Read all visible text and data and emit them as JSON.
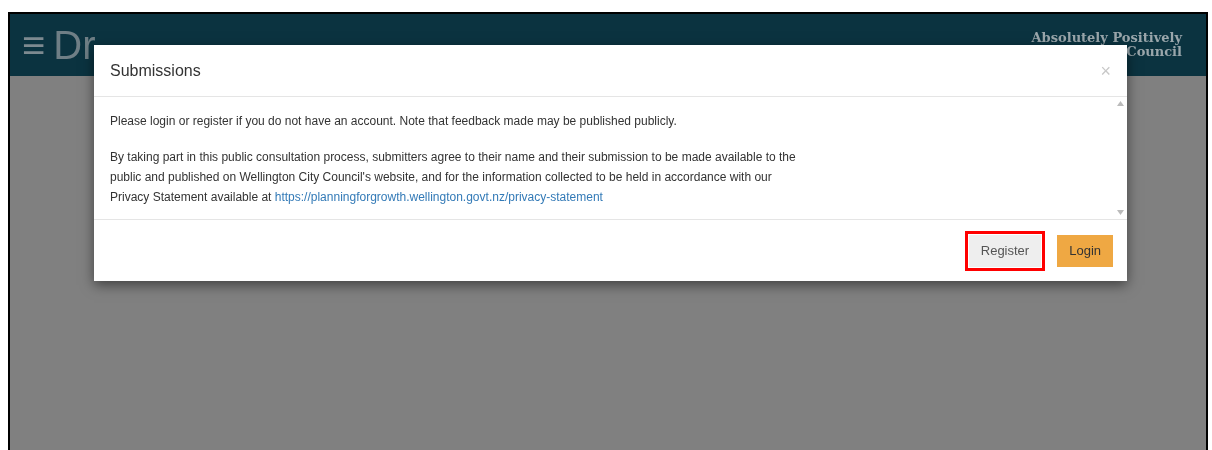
{
  "header": {
    "menu_icon": "≡",
    "title": "Dr",
    "logo_line_1": "Absolutely Positively",
    "logo_line_2": "Council"
  },
  "modal": {
    "title": "Submissions",
    "close": "×",
    "paragraphs": [
      {
        "text": "Please login or register if you do not have an account. Note that feedback made may be published publicly."
      },
      {
        "text": "By taking part in this public consultation process, submitters agree to their name and their submission to be made available to the public and published on Wellington City Council's website, and for the information collected to be held in accordance with our Privacy Statement available at ",
        "link": "https://planningforgrowth.wellington.govt.nz/privacy-statement"
      }
    ],
    "buttons": [
      {
        "label": "Register",
        "kind": "default",
        "highlighted": true
      },
      {
        "label": "Login",
        "kind": "primary",
        "highlighted": false
      }
    ]
  }
}
